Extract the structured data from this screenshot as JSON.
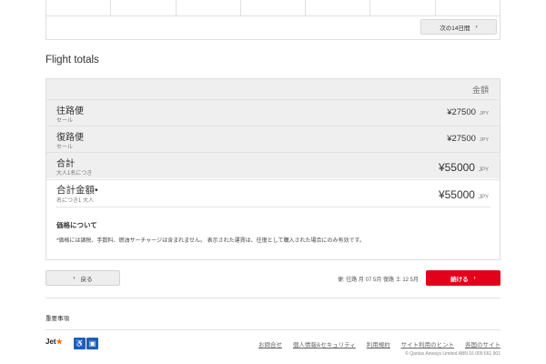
{
  "calendar": {
    "next_label": "次の14日間",
    "next_icon": "chevron-right-icon"
  },
  "section_title": "Flight totals",
  "totals": {
    "header": "金額",
    "rows": [
      {
        "label": "往路便",
        "sub": "セール",
        "amount": "¥27500",
        "currency": "JPY"
      },
      {
        "label": "復路便",
        "sub": "セール",
        "amount": "¥27500",
        "currency": "JPY"
      },
      {
        "label": "合計",
        "sub": "大人1名につき",
        "amount": "¥55000",
        "currency": "JPY"
      },
      {
        "label": "合計金額•",
        "sub": "名につき1 大人",
        "amount": "¥55000",
        "currency": "JPY"
      }
    ],
    "price_note_title": "価格について",
    "price_note": "*価格には諸税、手数料、燃油サーチャージは含まれません。 表示された運賃は、往復として購入された場合にのみ有効です。"
  },
  "actions": {
    "back_label": "戻る",
    "dates_text": "便: 往路 月 07 5月 復路 土 12 5月",
    "continue_label": "続ける",
    "accent_color": "#e3001b"
  },
  "important_label": "重要事項",
  "footer": {
    "logo_text": "Jet",
    "logo_star": "★",
    "links": [
      "お問合せ",
      "個人情報&セキュリティ",
      "利用規約",
      "サイト利用のヒント",
      "各国のサイト"
    ],
    "copyright": "© Qantas Airways Limited ABN 16 009 661 901"
  }
}
